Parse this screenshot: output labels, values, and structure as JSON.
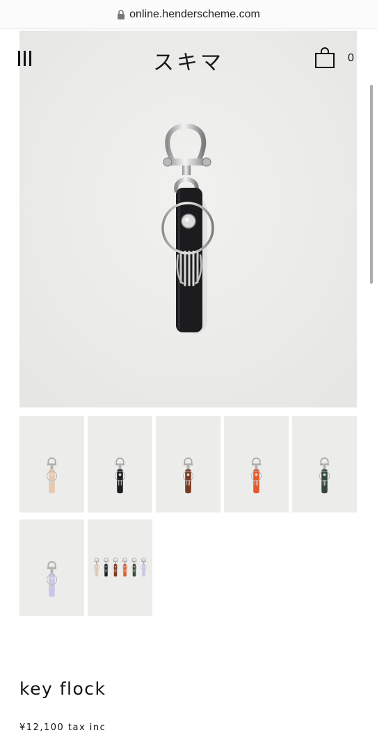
{
  "browser": {
    "url": "online.henderscheme.com",
    "lock_icon": "lock-icon"
  },
  "header": {
    "menu_icon": "hamburger-menu-icon",
    "logo_text": "スキマ",
    "cart_icon": "shopping-bag-icon",
    "cart_count": "0"
  },
  "hero": {
    "image": "black leather key holder with metal shackle and ring",
    "strap_color": "#1c1c1e"
  },
  "thumbnails": [
    {
      "name": "thumb-natural",
      "strap_color": "#e7c9b0"
    },
    {
      "name": "thumb-black",
      "strap_color": "#1d1f22"
    },
    {
      "name": "thumb-brown",
      "strap_color": "#7a3b22"
    },
    {
      "name": "thumb-orange",
      "strap_color": "#e45a2a"
    },
    {
      "name": "thumb-green",
      "strap_color": "#34493a"
    },
    {
      "name": "thumb-lavender",
      "strap_color": "#c8c7e6"
    },
    {
      "name": "thumb-all-colors",
      "strap_colors": [
        "#e7c9b0",
        "#1d1f22",
        "#7a3b22",
        "#e45a2a",
        "#34493a",
        "#c8c7e6"
      ]
    }
  ],
  "product": {
    "title": "key flock",
    "price": "¥12,100 tax inc"
  }
}
